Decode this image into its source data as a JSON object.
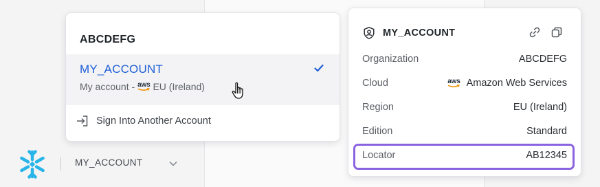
{
  "switcher": {
    "org_name": "ABCDEFG",
    "account": {
      "name": "MY_ACCOUNT",
      "description_prefix": "My account -",
      "cloud_logo": "aws",
      "region": "EU (Ireland)",
      "selected_icon": "checkmark-icon"
    },
    "sign_in_label": "Sign Into Another Account",
    "sign_in_icon": "sign-in-icon"
  },
  "brand_bar": {
    "logo_icon": "snowflake-logo",
    "account_label": "MY_ACCOUNT",
    "chevron_icon": "chevron-down-icon"
  },
  "details_card": {
    "title": "MY_ACCOUNT",
    "title_icon": "shield-user-icon",
    "actions": [
      "link-icon",
      "copy-icon"
    ],
    "rows": [
      {
        "label": "Organization",
        "value": "ABCDEFG"
      },
      {
        "label": "Cloud",
        "value": "Amazon Web Services",
        "logo": "aws"
      },
      {
        "label": "Region",
        "value": "EU (Ireland)"
      },
      {
        "label": "Edition",
        "value": "Standard"
      },
      {
        "label": "Locator",
        "value": "AB12345",
        "highlighted": true
      }
    ]
  },
  "colors": {
    "accent_blue": "#1f5fd6",
    "highlight_purple": "#8b63e0",
    "snowflake_blue": "#29b5e8"
  }
}
